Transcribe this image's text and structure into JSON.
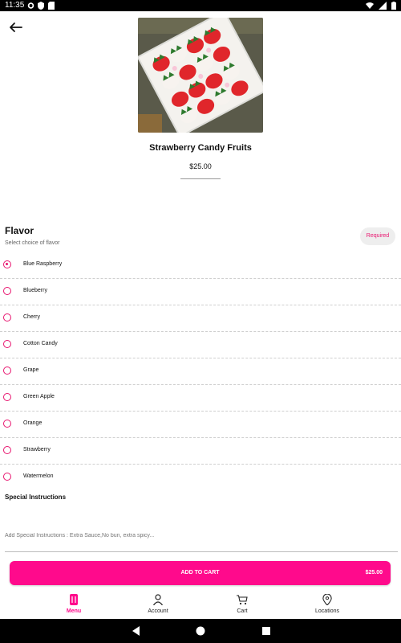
{
  "status_bar": {
    "time": "11:35"
  },
  "product": {
    "title": "Strawberry Candy Fruits",
    "price": "$25.00",
    "image_alt": "strawberry-box-photo"
  },
  "flavor_section": {
    "heading": "Flavor",
    "subheading": "Select choice of flavor",
    "badge": "Required",
    "selected_index": 0,
    "options": [
      {
        "label": "Blue Raspberry"
      },
      {
        "label": "Blueberry"
      },
      {
        "label": "Cherry"
      },
      {
        "label": "Cotton Candy"
      },
      {
        "label": "Grape"
      },
      {
        "label": "Green Apple"
      },
      {
        "label": "Orange"
      },
      {
        "label": "Strawberry"
      },
      {
        "label": "Watermelon"
      }
    ]
  },
  "special_instructions": {
    "heading": "Special Instructions",
    "placeholder": "Add Special Instructions : Extra Sauce,No bun, extra spicy..."
  },
  "add_to_cart": {
    "label": "ADD TO CART",
    "amount": "$25.00"
  },
  "tabs": [
    {
      "label": "Menu",
      "icon": "menu-utensils-icon",
      "active": true
    },
    {
      "label": "Account",
      "icon": "person-icon",
      "active": false
    },
    {
      "label": "Cart",
      "icon": "cart-icon",
      "active": false
    },
    {
      "label": "Locations",
      "icon": "location-pin-icon",
      "active": false
    }
  ],
  "colors": {
    "accent": "#ff0a8c",
    "required_text": "#e8156f"
  }
}
